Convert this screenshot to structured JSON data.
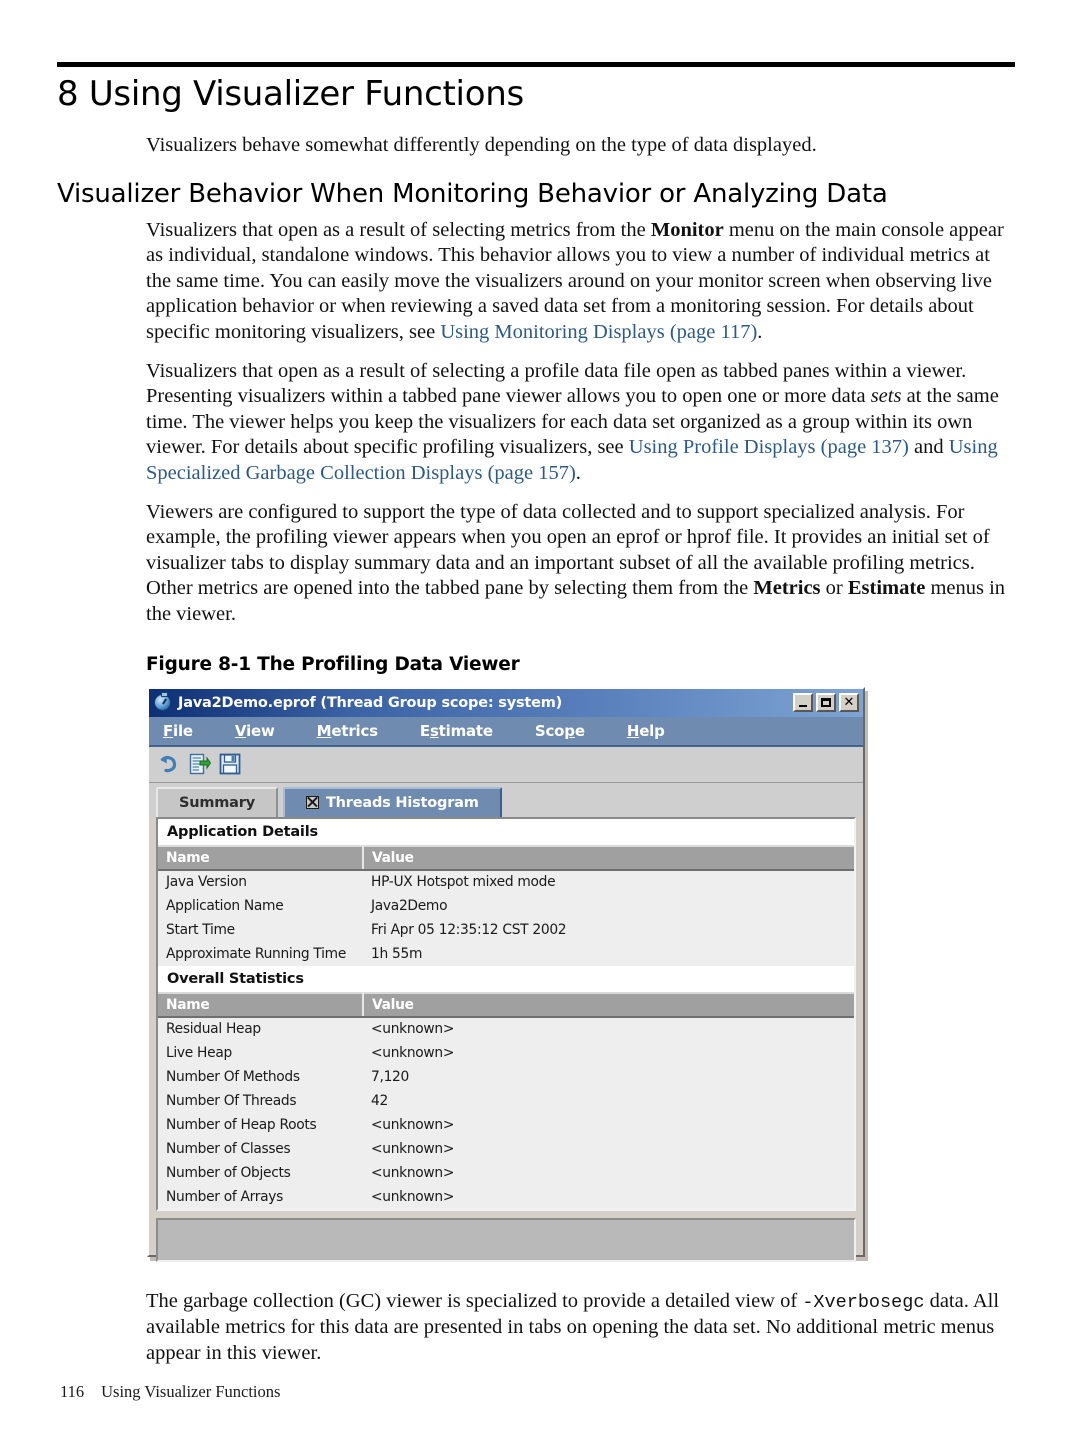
{
  "page": {
    "chapter_title": "8 Using Visualizer Functions",
    "intro": "Visualizers behave somewhat differently depending on the type of data displayed.",
    "section_heading": "Visualizer Behavior When Monitoring Behavior or Analyzing Data",
    "figure_caption": "Figure 8-1 The Profiling Data Viewer",
    "footer_page_number": "116",
    "footer_title": "Using Visualizer Functions"
  },
  "paragraphs": {
    "p1_a": "Visualizers that open as a result of selecting metrics from the ",
    "p1_bold": "Monitor",
    "p1_b": " menu on the main console appear as individual, standalone windows. This behavior allows you to view a number of individual metrics at the same time. You can easily move the visualizers around on your monitor screen when observing live application behavior or when reviewing a saved data set from a monitoring session. For details about specific monitoring visualizers, see ",
    "p1_link": "Using Monitoring Displays (page 117)",
    "p1_c": ".",
    "p2_a": "Visualizers that open as a result of selecting a profile data file open as tabbed panes within a viewer. Presenting visualizers within a tabbed pane viewer allows you to open one or more data ",
    "p2_italic": "sets",
    "p2_b": " at the same time. The viewer helps you keep the visualizers for each data set organized as a group within its own viewer. For details about specific profiling visualizers, see ",
    "p2_link1": "Using Profile Displays (page 137)",
    "p2_c": " and ",
    "p2_link2": "Using Specialized Garbage Collection Displays (page 157)",
    "p2_d": ".",
    "p3_a": "Viewers are configured to support the type of data collected and to support specialized analysis. For example, the profiling viewer appears when you open an eprof or hprof file. It provides an initial set of visualizer tabs to display summary data and an important subset of all the available profiling metrics. Other metrics are opened into the tabbed pane by selecting them from the ",
    "p3_bold1": "Metrics",
    "p3_b": " or ",
    "p3_bold2": "Estimate",
    "p3_c": " menus in the viewer.",
    "p4_a": "The garbage collection (GC) viewer is specialized to provide a detailed view of ",
    "p4_mono": "-Xverbosegc",
    "p4_b": " data. All available metrics for this data are presented in tabs on opening the data set. No additional metric menus appear in this viewer."
  },
  "app_window": {
    "title": "Java2Demo.eprof (Thread Group scope: system)",
    "app_icon": "stopwatch-icon",
    "window_controls": {
      "minimize": "minimize-icon",
      "maximize": "maximize-icon",
      "close": "close-icon"
    },
    "menus": [
      {
        "label": "File",
        "mnemonic": "F"
      },
      {
        "label": "View",
        "mnemonic": "V"
      },
      {
        "label": "Metrics",
        "mnemonic": "M"
      },
      {
        "label": "Estimate",
        "mnemonic": "E"
      },
      {
        "label": "Scope",
        "mnemonic": "p"
      },
      {
        "label": "Help",
        "mnemonic": "H"
      }
    ],
    "toolbar": [
      {
        "name": "undo-icon"
      },
      {
        "name": "refresh-document-icon"
      },
      {
        "name": "save-icon"
      }
    ],
    "tabs": [
      {
        "label": "Summary",
        "active": false,
        "closable": false
      },
      {
        "label": "Threads Histogram",
        "active": true,
        "closable": true
      }
    ],
    "groups": [
      {
        "title": "Application Details",
        "columns": [
          "Name",
          "Value"
        ],
        "rows": [
          [
            "Java Version",
            "HP-UX Hotspot mixed mode"
          ],
          [
            "Application Name",
            "Java2Demo"
          ],
          [
            "Start Time",
            "Fri Apr 05 12:35:12 CST 2002"
          ],
          [
            "Approximate Running Time",
            "1h 55m"
          ]
        ]
      },
      {
        "title": "Overall Statistics",
        "columns": [
          "Name",
          "Value"
        ],
        "rows": [
          [
            "Residual Heap",
            "<unknown>"
          ],
          [
            "Live Heap",
            "<unknown>"
          ],
          [
            "Number Of Methods",
            "7,120"
          ],
          [
            "Number Of Threads",
            "42"
          ],
          [
            "Number of Heap Roots",
            "<unknown>"
          ],
          [
            "Number of Classes",
            "<unknown>"
          ],
          [
            "Number of Objects",
            "<unknown>"
          ],
          [
            "Number of Arrays",
            "<unknown>"
          ]
        ]
      }
    ]
  },
  "colors": {
    "titlebar_start": "#0d2f73",
    "titlebar_end": "#7ea4d4",
    "menubar": "#6f8cb0",
    "toolbar": "#cfcfcf",
    "table_header": "#a0a0a0",
    "table_row": "#eeeeee",
    "link": "#2c5a86",
    "window_face": "#d4d0c8"
  }
}
